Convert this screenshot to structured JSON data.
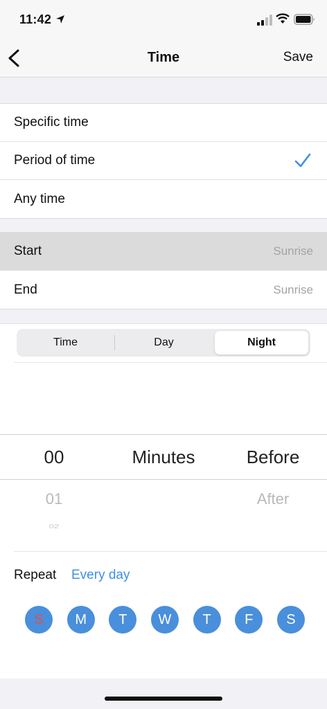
{
  "status_bar": {
    "time": "11:42"
  },
  "nav": {
    "title": "Time",
    "save_label": "Save"
  },
  "time_type": {
    "options": [
      "Specific time",
      "Period of time",
      "Any time"
    ],
    "selected": "Period of time"
  },
  "range": {
    "start_label": "Start",
    "start_value": "Sunrise",
    "end_label": "End",
    "end_value": "Sunrise"
  },
  "segment": {
    "items": [
      "Time",
      "Day",
      "Night"
    ],
    "selected": "Night"
  },
  "picker": {
    "minutes": {
      "selected": "00",
      "next": "01",
      "next2": "02"
    },
    "unit": "Minutes",
    "relation": {
      "selected": "Before",
      "next": "After"
    }
  },
  "repeat": {
    "label": "Repeat",
    "value": "Every day",
    "days": [
      "S",
      "M",
      "T",
      "W",
      "T",
      "F",
      "S"
    ]
  },
  "colors": {
    "accent": "#3e8fe6",
    "day_circle": "#4a8fdb",
    "sunday_text": "#e0504a"
  }
}
